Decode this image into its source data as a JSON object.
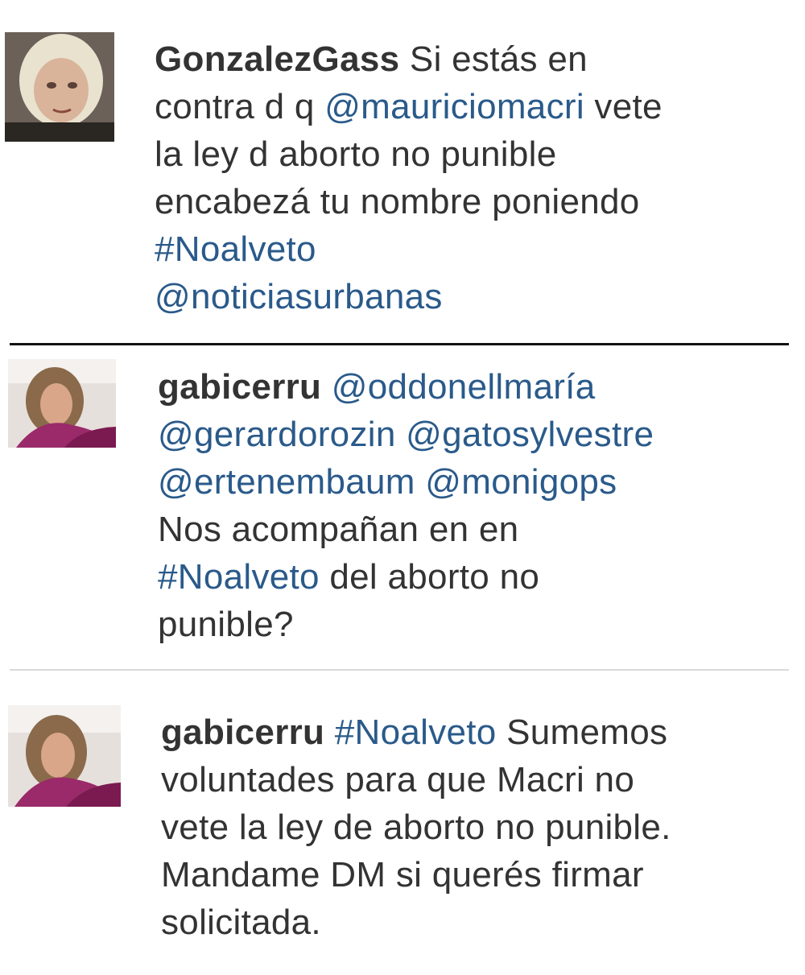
{
  "tweets": [
    {
      "username": "GonzalezGass",
      "avatar_icon": "user-avatar-icon",
      "lines": [
        [
          {
            "t": "username",
            "v": "GonzalezGass"
          },
          {
            "t": "text",
            "v": " Si estás en"
          }
        ],
        [
          {
            "t": "text",
            "v": "contra d q "
          },
          {
            "t": "mention",
            "v": "@mauriciomacri"
          },
          {
            "t": "text",
            "v": " vete"
          }
        ],
        [
          {
            "t": "text",
            "v": "la ley d aborto no punible"
          }
        ],
        [
          {
            "t": "text",
            "v": "encabezá tu nombre poniendo"
          }
        ],
        [
          {
            "t": "hashtag",
            "v": "#Noalveto"
          }
        ],
        [
          {
            "t": "mention",
            "v": "@noticiasurbanas"
          }
        ]
      ]
    },
    {
      "username": "gabicerru",
      "avatar_icon": "user-avatar-icon",
      "lines": [
        [
          {
            "t": "username",
            "v": "gabicerru"
          },
          {
            "t": "text",
            "v": " "
          },
          {
            "t": "mention",
            "v": "@oddonellmaría"
          }
        ],
        [
          {
            "t": "mention",
            "v": "@gerardorozin"
          },
          {
            "t": "text",
            "v": " "
          },
          {
            "t": "mention",
            "v": "@gatosylvestre"
          }
        ],
        [
          {
            "t": "mention",
            "v": "@ertenembaum"
          },
          {
            "t": "text",
            "v": " "
          },
          {
            "t": "mention",
            "v": "@monigops"
          }
        ],
        [
          {
            "t": "text",
            "v": "Nos acompañan en en"
          }
        ],
        [
          {
            "t": "hashtag",
            "v": "#Noalveto"
          },
          {
            "t": "text",
            "v": " del aborto no"
          }
        ],
        [
          {
            "t": "text",
            "v": "punible?"
          }
        ]
      ]
    },
    {
      "username": "gabicerru",
      "avatar_icon": "user-avatar-icon",
      "lines": [
        [
          {
            "t": "username",
            "v": "gabicerru"
          },
          {
            "t": "text",
            "v": " "
          },
          {
            "t": "hashtag",
            "v": "#Noalveto"
          },
          {
            "t": "text",
            "v": " Sumemos"
          }
        ],
        [
          {
            "t": "text",
            "v": "voluntades para que Macri no"
          }
        ],
        [
          {
            "t": "text",
            "v": "vete la ley de aborto no punible."
          }
        ],
        [
          {
            "t": "text",
            "v": "Mandame DM si querés firmar"
          }
        ],
        [
          {
            "t": "text",
            "v": "solicitada."
          }
        ]
      ]
    }
  ],
  "colors": {
    "text": "#333333",
    "link": "#2a5a8a",
    "divider_dark": "#111111",
    "divider_light": "#d9d9d9"
  }
}
